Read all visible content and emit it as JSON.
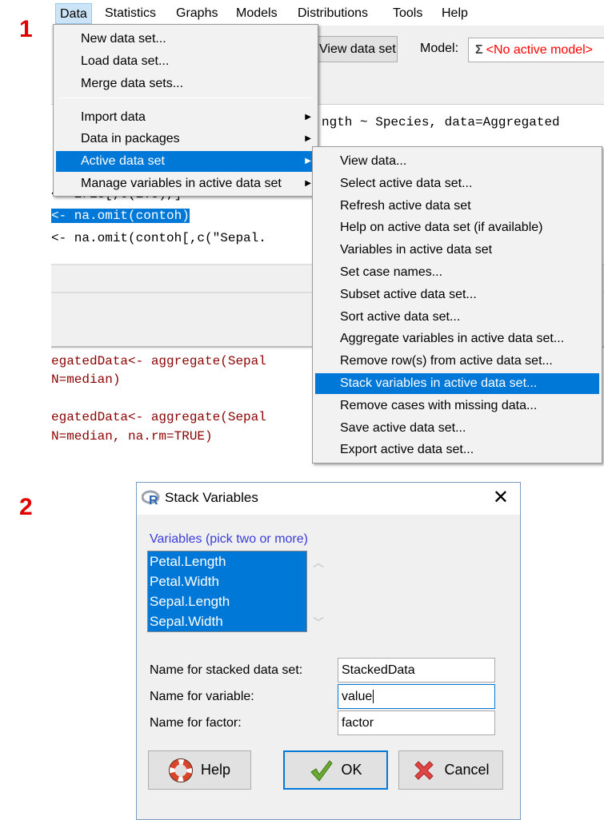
{
  "steps": {
    "first": "1",
    "second": "2"
  },
  "menubar": {
    "items": [
      "Data",
      "Statistics",
      "Graphs",
      "Models",
      "Distributions",
      "Tools",
      "Help"
    ],
    "active": "Data"
  },
  "toolbar": {
    "view_data_set": "View data set",
    "model_label": "Model:",
    "model_value": "<No active model>"
  },
  "script": {
    "lines": [
      "ngth ~ Species, data=Aggregated",
      "<- iris[,c(1:5),]",
      "<- na.omit(contoh)",
      "<- na.omit(contoh[,c(\"Sepal."
    ]
  },
  "output": {
    "lines": [
      "egatedData<- aggregate(Sepal",
      "N=median)",
      "egatedData<- aggregate(Sepal",
      "N=median, na.rm=TRUE)"
    ]
  },
  "data_menu": {
    "items": [
      "New data set...",
      "Load data set...",
      "Merge data sets...",
      "Import data",
      "Data in packages",
      "Active data set",
      "Manage variables in active data set"
    ],
    "selected": "Active data set"
  },
  "active_submenu": {
    "items": [
      "View data...",
      "Select active data set...",
      "Refresh active data set",
      "Help on active data set (if available)",
      "Variables in active data set",
      "Set case names...",
      "Subset active data set...",
      "Sort active data set...",
      "Aggregate variables in active data set...",
      "Remove row(s) from active data set...",
      "Stack variables in active data set...",
      "Remove cases with missing data...",
      "Save active data set...",
      "Export active data set..."
    ],
    "selected": "Stack variables in active data set..."
  },
  "dialog": {
    "title": "Stack Variables",
    "variables_label": "Variables (pick two or more)",
    "variables": [
      "Petal.Length",
      "Petal.Width",
      "Sepal.Length",
      "Sepal.Width"
    ],
    "fields": [
      {
        "label": "Name for stacked data set:",
        "value": "StackedData"
      },
      {
        "label": "Name for variable:",
        "value": "value"
      },
      {
        "label": "Name for factor:",
        "value": "factor"
      }
    ],
    "buttons": {
      "help": "Help",
      "ok": "OK",
      "cancel": "Cancel"
    }
  },
  "colors": {
    "accent": "#0078d7",
    "step_label": "#e00000",
    "code_output": "#8b0000",
    "model_none": "#ff0000",
    "variables_label": "#3b3bd8"
  }
}
